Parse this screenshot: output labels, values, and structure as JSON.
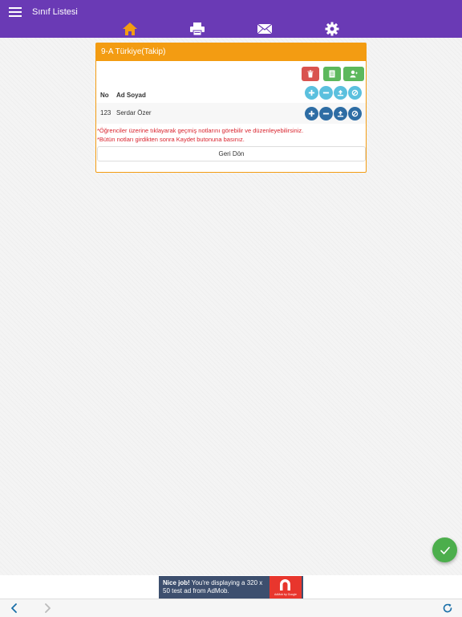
{
  "header": {
    "title": "Sınıf Listesi",
    "menu_icon": "hamburger-menu-icon",
    "nav": [
      {
        "name": "home-icon",
        "color": "#f39c12"
      },
      {
        "name": "print-icon",
        "color": "#ffffff"
      },
      {
        "name": "mail-icon",
        "color": "#ffffff"
      },
      {
        "name": "settings-icon",
        "color": "#ffffff"
      }
    ],
    "background": "#6a3ab5"
  },
  "card": {
    "title": "9-A Türkiye(Takip)",
    "accent": "#f39c12",
    "actions": [
      {
        "name": "delete-icon",
        "color": "#d9534f"
      },
      {
        "name": "list-icon",
        "color": "#5cb85c"
      },
      {
        "name": "add-user-icon",
        "color": "#5cb85c"
      }
    ],
    "table": {
      "headers": [
        "No",
        "Ad Soyad"
      ],
      "header_buttons": [
        "plus-icon",
        "minus-icon",
        "upload-icon",
        "ban-icon"
      ],
      "rows": [
        {
          "no": "123",
          "name": "Serdar Özer",
          "buttons": [
            "plus-icon",
            "minus-icon",
            "upload-icon",
            "ban-icon"
          ]
        }
      ]
    },
    "notes": [
      "*Öğrenciler üzerine tıklayarak geçmiş notlarını görebilir ve düzenleyebilirsiniz.",
      "*Bütün notları girdikten sonra Kaydet butonuna basınız."
    ],
    "back_button": "Geri Dön"
  },
  "fab": {
    "icon": "check-icon",
    "color": "#4cae4c"
  },
  "ad": {
    "bold": "Nice job!",
    "text": " You're displaying a 320 x 50 test ad from AdMob.",
    "logo_text": "AdMob by Google"
  },
  "toolbar": {
    "back": "chevron-left-icon",
    "forward": "chevron-right-icon",
    "reload": "reload-icon"
  }
}
